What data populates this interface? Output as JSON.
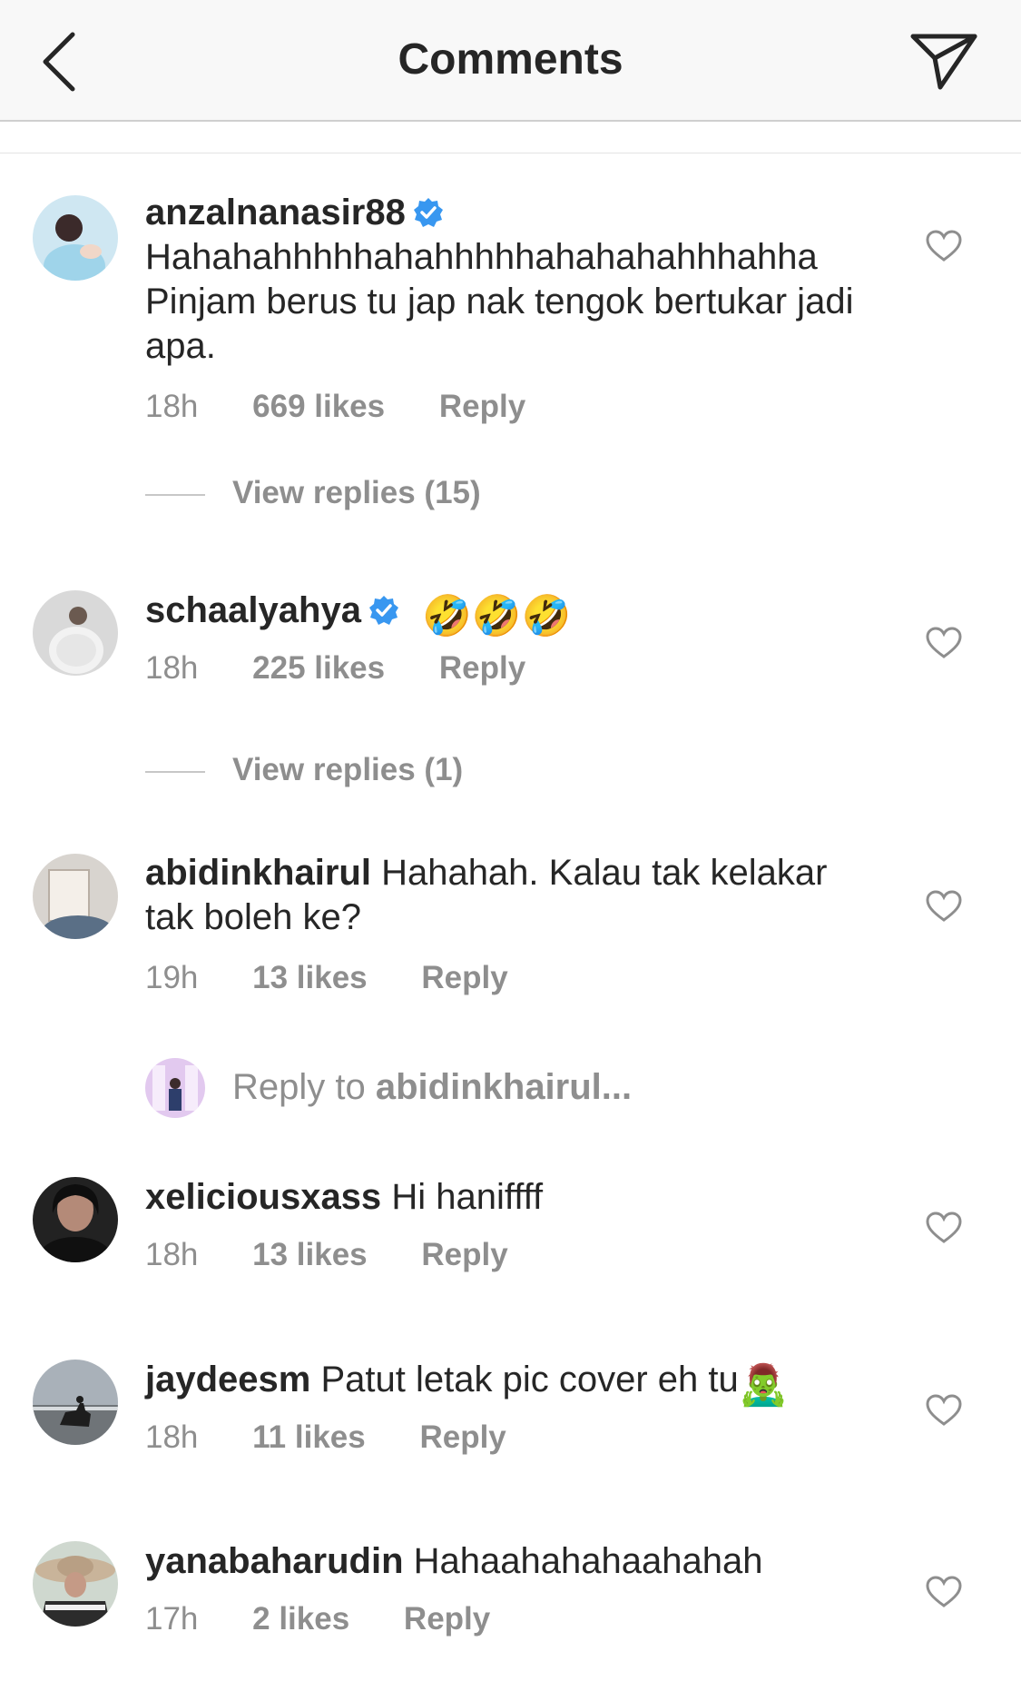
{
  "header": {
    "title": "Comments",
    "back_icon": "chevron-left-icon",
    "share_icon": "send-icon"
  },
  "comments": [
    {
      "username": "anzalnanasir88",
      "verified": true,
      "text": "Hahahahhhhhahahhhhhahahahahhhahha Pinjam berus tu jap nak tengok bertukar jadi apa.",
      "time": "18h",
      "likes": "669 likes",
      "reply": "Reply",
      "view_replies": "View replies (15)"
    },
    {
      "username": "schaalyahya",
      "verified": true,
      "text": "🤣🤣🤣",
      "time": "18h",
      "likes": "225 likes",
      "reply": "Reply",
      "view_replies": "View replies (1)"
    },
    {
      "username": "abidinkhairul",
      "verified": false,
      "text": "Hahahah. Kalau tak kelakar tak boleh ke?",
      "time": "19h",
      "likes": "13 likes",
      "reply": "Reply",
      "reply_to_prefix": "Reply to ",
      "reply_to_user": "abidinkhairul...",
      "reply_to_suffix": ""
    },
    {
      "username": "xeliciousxass",
      "verified": false,
      "text": "Hi haniffff",
      "time": "18h",
      "likes": "13 likes",
      "reply": "Reply"
    },
    {
      "username": "jaydeesm",
      "verified": false,
      "text": "Patut letak pic cover eh tu",
      "emoji": "🧟‍♂️",
      "time": "18h",
      "likes": "11 likes",
      "reply": "Reply"
    },
    {
      "username": "yanabaharudin",
      "verified": false,
      "text": "Hahaahahahaahahah",
      "time": "17h",
      "likes": "2 likes",
      "reply": "Reply"
    }
  ],
  "colors": {
    "verified_blue": "#3897f0",
    "meta_gray": "#8e8e8e",
    "text": "#262626"
  }
}
